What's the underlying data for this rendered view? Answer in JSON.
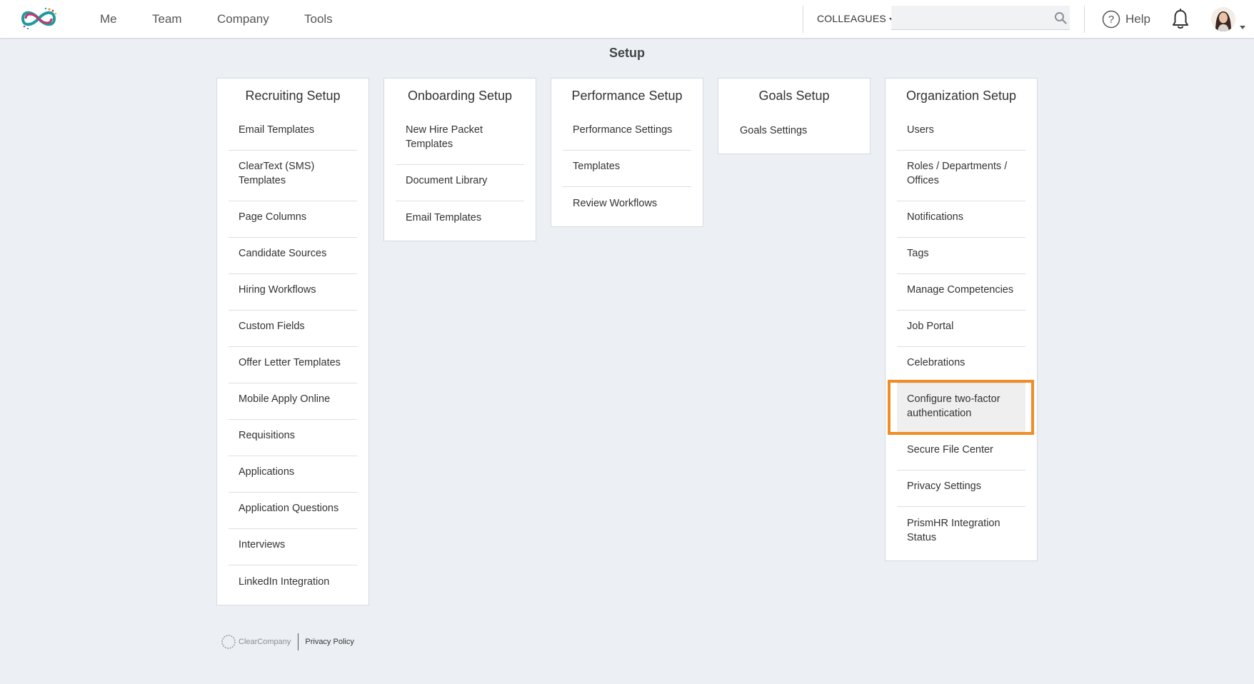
{
  "nav": {
    "links": [
      "Me",
      "Team",
      "Company",
      "Tools"
    ],
    "search_scope": "COLLEAGUES",
    "search_placeholder": "",
    "help_label": "Help"
  },
  "page": {
    "title": "Setup"
  },
  "cards": [
    {
      "title": "Recruiting Setup",
      "items": [
        "Email Templates",
        "ClearText (SMS) Templates",
        "Page Columns",
        "Candidate Sources",
        "Hiring Workflows",
        "Custom Fields",
        "Offer Letter Templates",
        "Mobile Apply Online",
        "Requisitions",
        "Applications",
        "Application Questions",
        "Interviews",
        "LinkedIn Integration"
      ]
    },
    {
      "title": "Onboarding Setup",
      "items": [
        "New Hire Packet Templates",
        "Document Library",
        "Email Templates"
      ]
    },
    {
      "title": "Performance Setup",
      "items": [
        "Performance Settings",
        "Templates",
        "Review Workflows"
      ]
    },
    {
      "title": "Goals Setup",
      "items": [
        "Goals Settings"
      ]
    },
    {
      "title": "Organization Setup",
      "items": [
        "Users",
        "Roles / Departments / Offices",
        "Notifications",
        "Tags",
        "Manage Competencies",
        "Job Portal",
        "Celebrations",
        "Configure two-factor authentication",
        "Secure File Center",
        "Privacy Settings",
        "PrismHR Integration Status"
      ]
    }
  ],
  "footer": {
    "brand": "ClearCompany",
    "privacy_link": "Privacy Policy"
  },
  "colors": {
    "highlight": "#f28c26",
    "background": "#ecf0f5",
    "logo_teal": "#1e9aa0",
    "logo_pink": "#c8336b"
  }
}
